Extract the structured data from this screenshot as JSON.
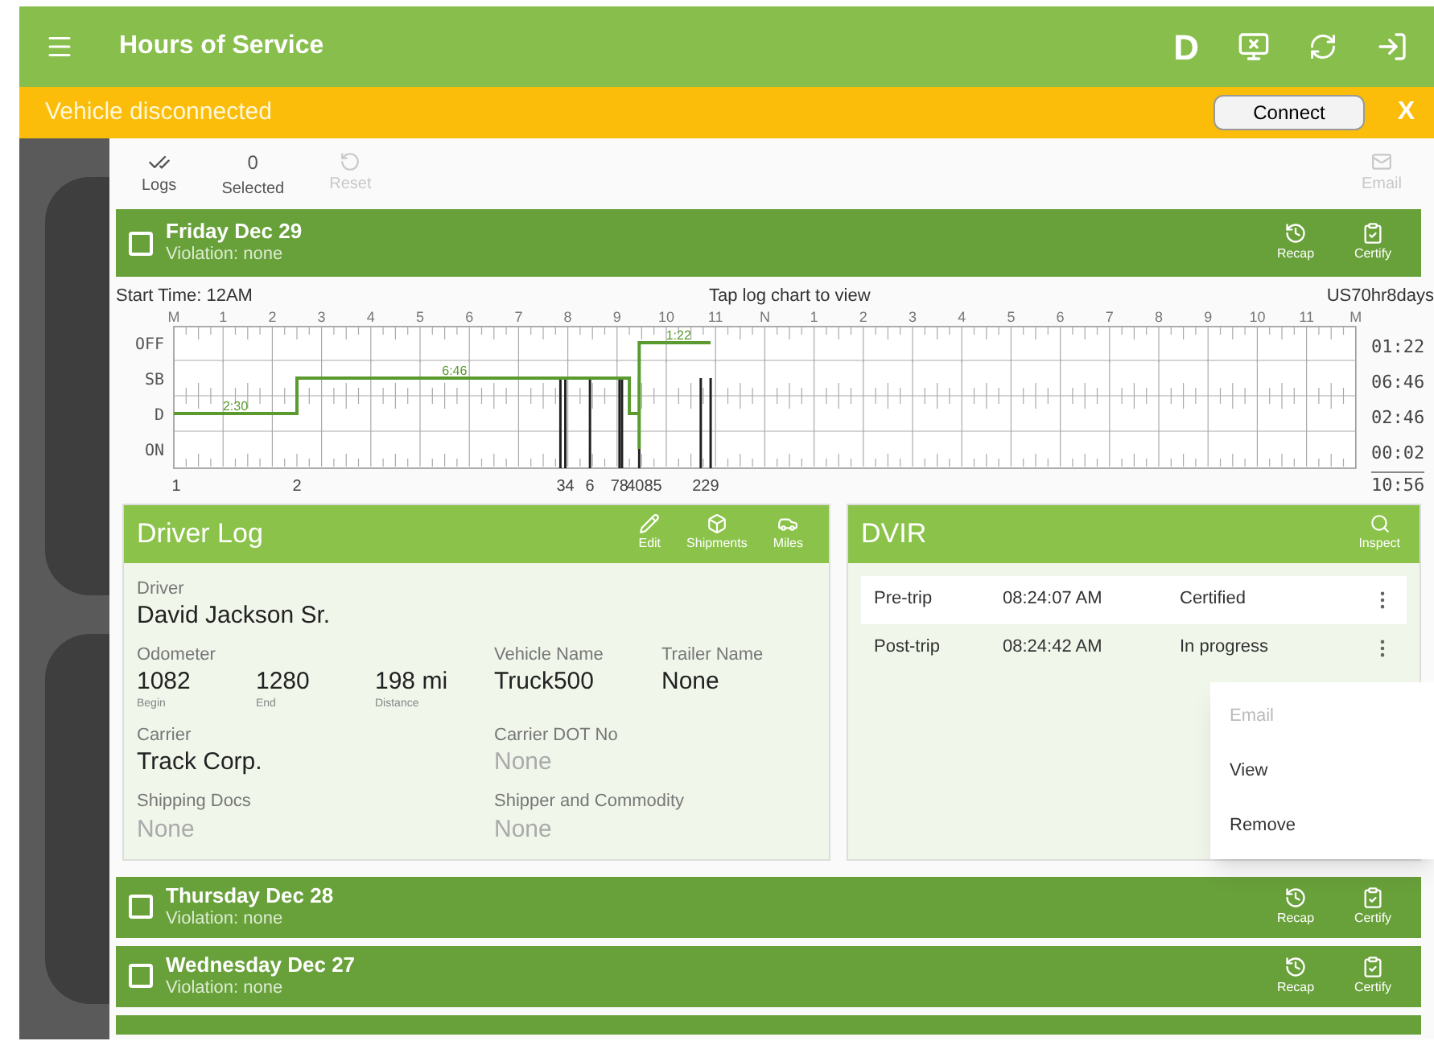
{
  "app_bar": {
    "title": "Hours of Service",
    "status_letter": "D"
  },
  "banner": {
    "message": "Vehicle disconnected",
    "button": "Connect",
    "close": "X"
  },
  "toolbar": {
    "logs": "Logs",
    "selected_count": "0",
    "selected_label": "Selected",
    "reset": {
      "label": "Reset",
      "disabled": true
    },
    "email": {
      "label": "Email",
      "disabled": true
    }
  },
  "days": [
    {
      "title": "Friday Dec 29",
      "violation": "Violation: none",
      "checked": false,
      "actions": [
        "Recap",
        "Certify"
      ]
    },
    {
      "title": "Thursday Dec 28",
      "violation": "Violation: none",
      "checked": false,
      "actions": [
        "Recap",
        "Certify"
      ]
    },
    {
      "title": "Wednesday Dec 27",
      "violation": "Violation: none",
      "checked": false,
      "actions": [
        "Recap",
        "Certify"
      ]
    }
  ],
  "chart": {
    "start_time": "Start Time: 12AM",
    "hint": "Tap log chart to view",
    "ruleset": "US70hr8days",
    "hour_labels": [
      "M",
      "1",
      "2",
      "3",
      "4",
      "5",
      "6",
      "7",
      "8",
      "9",
      "10",
      "11",
      "N",
      "1",
      "2",
      "3",
      "4",
      "5",
      "6",
      "7",
      "8",
      "9",
      "10",
      "11",
      "M"
    ],
    "status_labels": [
      "OFF",
      "SB",
      "D",
      "ON"
    ],
    "totals": [
      "01:22",
      "06:46",
      "02:46",
      "00:02"
    ],
    "grand_total": "10:56",
    "segment_labels": [
      "2:30",
      "6:46",
      "1:22"
    ],
    "event_labels": [
      "1",
      "2",
      "34",
      "6",
      "78",
      "4085",
      "229"
    ]
  },
  "driver_log": {
    "title": "Driver Log",
    "actions": [
      "Edit",
      "Shipments",
      "Miles"
    ],
    "driver_label": "Driver",
    "driver": "David Jackson Sr.",
    "odometer_label": "Odometer",
    "odometer": [
      {
        "value": "1082",
        "caption": "Begin"
      },
      {
        "value": "1280",
        "caption": "End"
      },
      {
        "value": "198 mi",
        "caption": "Distance"
      }
    ],
    "vehicle_label": "Vehicle Name",
    "vehicle": "Truck500",
    "trailer_label": "Trailer Name",
    "trailer": "None",
    "carrier_label": "Carrier",
    "carrier": "Track Corp.",
    "dot_label": "Carrier DOT No",
    "dot": "None",
    "docs_label": "Shipping Docs",
    "docs": "None",
    "shipper_label": "Shipper and Commodity",
    "shipper": "None"
  },
  "dvir": {
    "title": "DVIR",
    "action": "Inspect",
    "rows": [
      {
        "type": "Pre-trip",
        "time": "08:24:07 AM",
        "status": "Certified",
        "selected": true
      },
      {
        "type": "Post-trip",
        "time": "08:24:42 AM",
        "status": "In progress",
        "selected": false
      }
    ],
    "menu": [
      {
        "label": "Email",
        "disabled": true
      },
      {
        "label": "View",
        "disabled": false
      },
      {
        "label": "Remove",
        "disabled": false
      }
    ]
  }
}
